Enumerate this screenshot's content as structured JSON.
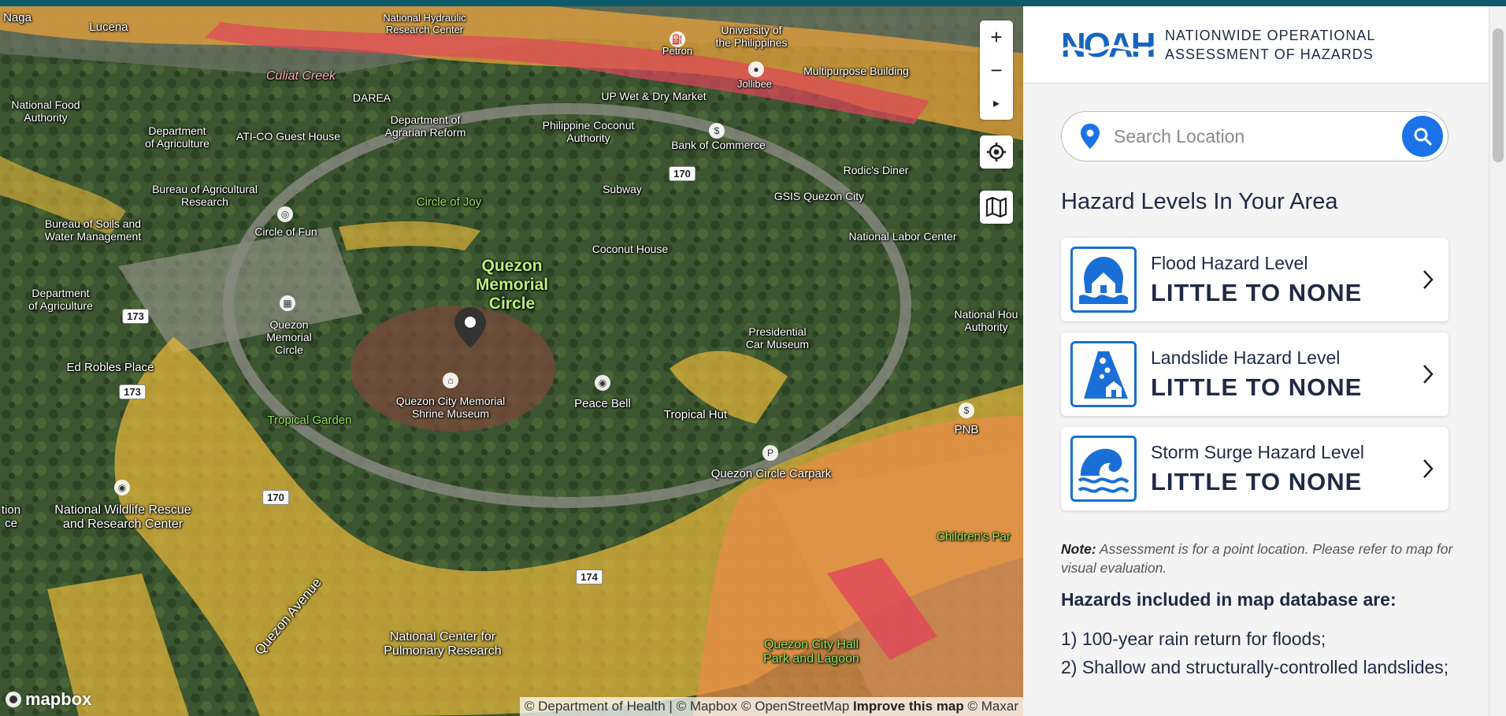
{
  "app": {
    "logo_text": "NOAH",
    "title_line1": "NATIONWIDE OPERATIONAL",
    "title_line2": "ASSESSMENT OF HAZARDS"
  },
  "search": {
    "placeholder": "Search Location"
  },
  "hazards": {
    "heading": "Hazard Levels In Your Area",
    "cards": [
      {
        "name": "Flood Hazard Level",
        "level": "LITTLE TO NONE",
        "icon": "flood-icon"
      },
      {
        "name": "Landslide Hazard Level",
        "level": "LITTLE TO NONE",
        "icon": "landslide-icon"
      },
      {
        "name": "Storm Surge Hazard Level",
        "level": "LITTLE TO NONE",
        "icon": "storm-surge-icon"
      }
    ],
    "note_label": "Note:",
    "note_text": " Assessment is for a point location. Please refer to map for visual evaluation.",
    "db_title": "Hazards included in map database are:",
    "db_items": [
      "1) 100-year rain return for floods;",
      "2) Shallow and structurally-controlled landslides;"
    ]
  },
  "map": {
    "controls": [
      "+",
      "−",
      "▸",
      "◎",
      "🗺"
    ],
    "attribution_a": "© Department of Health | © Mapbox © OpenStreetMap ",
    "attribution_b": "Improve this map",
    "attribution_c": " © Maxar",
    "mapbox_logo": "mapbox",
    "labels": {
      "naga": "Naga",
      "lucena": "Lucena",
      "nhrc": "National Hydraulic\nResearch Center",
      "up": "University of\nthe Philippines",
      "petron": "Petron",
      "jollibee": "Jollibee",
      "multi": "Multipurpose Building",
      "culiat": "Culiat Creek",
      "nfa": "National Food\nAuthority",
      "darea": "DAREA",
      "dar": "Department of\nAgrarian Reform",
      "upwet": "UP Wet & Dry Market",
      "da1": "Department\nof Agriculture",
      "atico": "ATI-CO Guest House",
      "pca": "Philippine Coconut\nAuthority",
      "boc": "Bank of Commerce",
      "rodics": "Rodic's Diner",
      "bar": "Bureau of Agricultural\nResearch",
      "subway": "Subway",
      "gsis": "GSIS Quezon City",
      "coj": "Circle of Joy",
      "bswm": "Bureau of Soils and\nWater Management",
      "cof": "Circle of Fun",
      "coconut": "Coconut House",
      "nlc": "National Labor Center",
      "qmc_big": "Quezon\nMemorial\nCircle",
      "da2": "Department\nof Agriculture",
      "qmc_st": "Quezon\nMemorial\nCircle",
      "pcm": "Presidential\nCar Museum",
      "nha": "National Hou\nAuthority",
      "erp": "Ed Robles Place",
      "museum": "Quezon City Memorial\nShrine Museum",
      "peacebell": "Peace Bell",
      "tropicalhut": "Tropical Hut",
      "tgarden": "Tropical Garden",
      "pnb": "PNB",
      "carpark": "Quezon Circle Carpark",
      "nwrrc": "National Wildlife Rescue\nand Research Center",
      "tion": "tion\nce",
      "childrens": "Children's Par",
      "qave": "Quezon Avenue",
      "ncpr": "National Center for\nPulmonary Research",
      "qchall": "Quezon City Hall\nPark and Lagoon"
    },
    "roads": [
      "170",
      "173",
      "173",
      "170",
      "174"
    ]
  }
}
